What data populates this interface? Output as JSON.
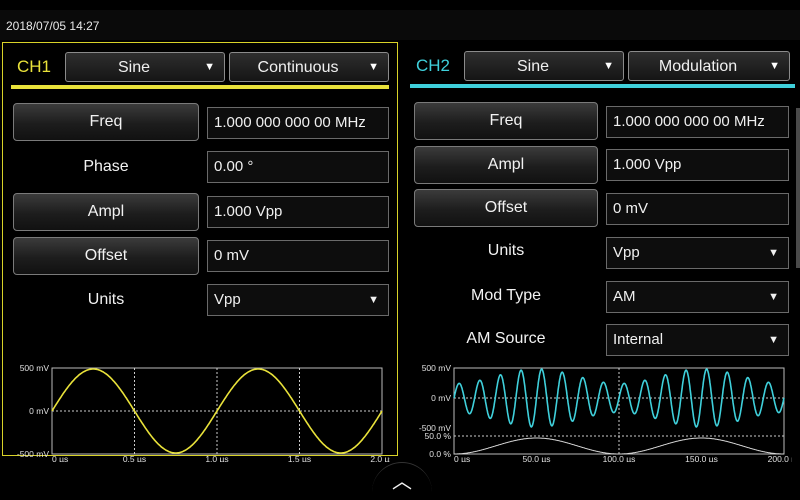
{
  "status": {
    "datetime": "2018/07/05 14:27"
  },
  "ch1": {
    "label": "CH1",
    "waveform": "Sine",
    "mode": "Continuous",
    "color": "#e9e23a",
    "rows": [
      {
        "label": "Freq",
        "value": "1.000 000 000 00 MHz",
        "button": true
      },
      {
        "label": "Phase",
        "value": "0.00 °",
        "button": false
      },
      {
        "label": "Ampl",
        "value": "1.000 Vpp",
        "button": true
      },
      {
        "label": "Offset",
        "value": "0 mV",
        "button": true
      },
      {
        "label": "Units",
        "value": "Vpp",
        "button": false,
        "dropdown": true
      }
    ],
    "scope": {
      "y_ticks": [
        "500 mV",
        "0 mV",
        "-500 mV"
      ],
      "x_ticks": [
        "0 µs",
        "0.5 µs",
        "1.0 µs",
        "1.5 µs",
        "2.0 µs"
      ],
      "cycles": 2
    }
  },
  "ch2": {
    "label": "CH2",
    "waveform": "Sine",
    "mode": "Modulation",
    "color": "#3fd0db",
    "rows": [
      {
        "label": "Freq",
        "value": "1.000 000 000 00 MHz",
        "button": true
      },
      {
        "label": "Ampl",
        "value": "1.000 Vpp",
        "button": true
      },
      {
        "label": "Offset",
        "value": "0 mV",
        "button": true
      },
      {
        "label": "Units",
        "value": "Vpp",
        "button": false,
        "dropdown": true
      },
      {
        "label": "Mod Type",
        "value": "AM",
        "button": false,
        "dropdown": true
      },
      {
        "label": "AM Source",
        "value": "Internal",
        "button": false,
        "dropdown": true
      }
    ],
    "scope": {
      "y_ticks": [
        "500 mV",
        "0 mV",
        "-500 mV",
        "50.0 %",
        "0.0 %"
      ],
      "x_ticks": [
        "0 µs",
        "50.0 µs",
        "100.0 µs",
        "150.0 µs",
        "200.0 µs"
      ],
      "carrier_cycles": 16,
      "modulation_cycles": 2
    }
  },
  "icons": {
    "dropdown": "▼",
    "expand": "︿"
  }
}
